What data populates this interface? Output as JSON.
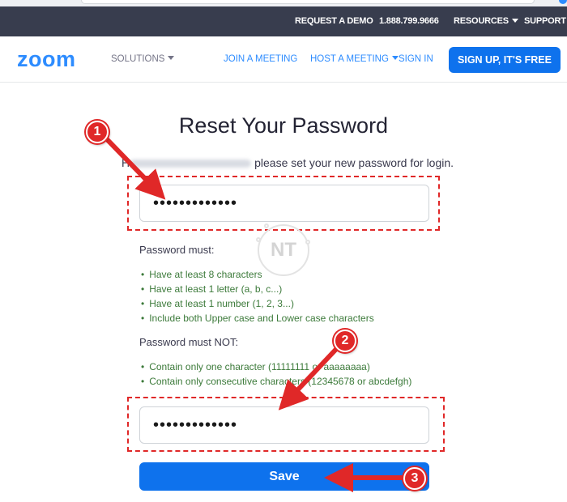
{
  "topbar": {
    "request_demo": "REQUEST A DEMO",
    "phone": "1.888.799.9666",
    "resources": "RESOURCES",
    "support": "SUPPORT"
  },
  "nav": {
    "logo": "zoom",
    "solutions": "SOLUTIONS",
    "join_meeting": "JOIN A MEETING",
    "host_meeting": "HOST A MEETING",
    "sign_in": "SIGN IN",
    "sign_up": "SIGN UP, IT'S FREE"
  },
  "form": {
    "title": "Reset Your Password",
    "intro_prefix": "H",
    "intro_text": "please set your new password for login.",
    "password_value": "•••••••••••••",
    "confirm_value": "•••••••••••••",
    "must_label": "Password must:",
    "must_rules": [
      "Have at least 8 characters",
      "Have at least 1 letter (a, b, c...)",
      "Have at least 1 number (1, 2, 3...)",
      "Include both Upper case and Lower case characters"
    ],
    "must_not_label": "Password must NOT:",
    "must_not_rules": [
      "Contain only one character (11111111 or aaaaaaaa)",
      "Contain only consecutive characters (12345678 or abcdefgh)"
    ],
    "save_label": "Save"
  },
  "annotations": {
    "marker_1": "1",
    "marker_2": "2",
    "marker_3": "3",
    "watermark": "NT",
    "color": "#e02828"
  },
  "colors": {
    "brand_blue": "#2d8cff",
    "button_blue": "#0e72ed",
    "topbar_bg": "#383d4e",
    "rule_green": "#3c7a3a"
  }
}
